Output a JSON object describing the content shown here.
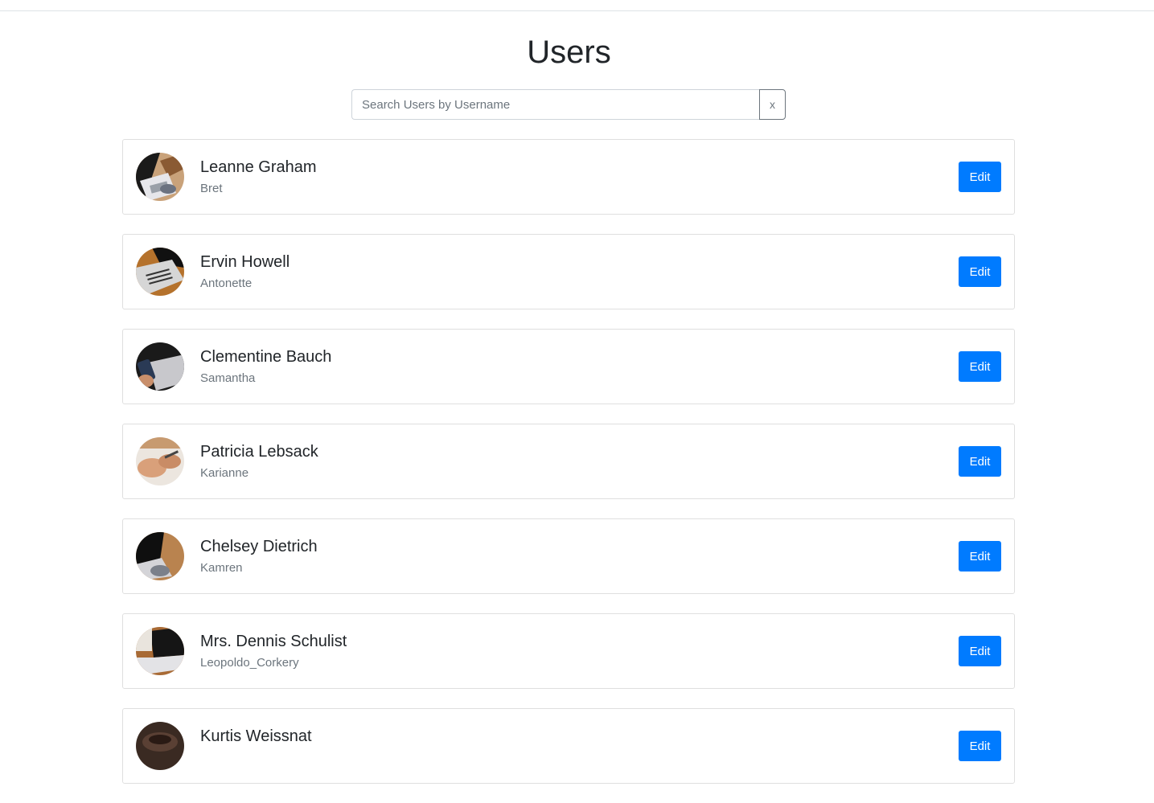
{
  "page": {
    "title": "Users"
  },
  "search": {
    "placeholder": "Search Users by Username",
    "value": "",
    "clear_label": "x"
  },
  "users": [
    {
      "name": "Leanne Graham",
      "username": "Bret",
      "edit_label": "Edit",
      "avatar_icon": "laptop-typing-photo"
    },
    {
      "name": "Ervin Howell",
      "username": "Antonette",
      "edit_label": "Edit",
      "avatar_icon": "laptop-keyboard-photo"
    },
    {
      "name": "Clementine Bauch",
      "username": "Samantha",
      "edit_label": "Edit",
      "avatar_icon": "phone-laptop-photo"
    },
    {
      "name": "Patricia Lebsack",
      "username": "Karianne",
      "edit_label": "Edit",
      "avatar_icon": "hands-writing-photo"
    },
    {
      "name": "Chelsey Dietrich",
      "username": "Kamren",
      "edit_label": "Edit",
      "avatar_icon": "laptop-desk-photo"
    },
    {
      "name": "Mrs. Dennis Schulist",
      "username": "Leopoldo_Corkery",
      "edit_label": "Edit",
      "avatar_icon": "open-laptop-photo"
    },
    {
      "name": "Kurtis Weissnat",
      "username": "",
      "edit_label": "Edit",
      "avatar_icon": "coffee-photo"
    }
  ],
  "colors": {
    "primary": "#007bff",
    "border": "#dfdfdf",
    "muted_text": "#6c757d",
    "text": "#212529"
  }
}
